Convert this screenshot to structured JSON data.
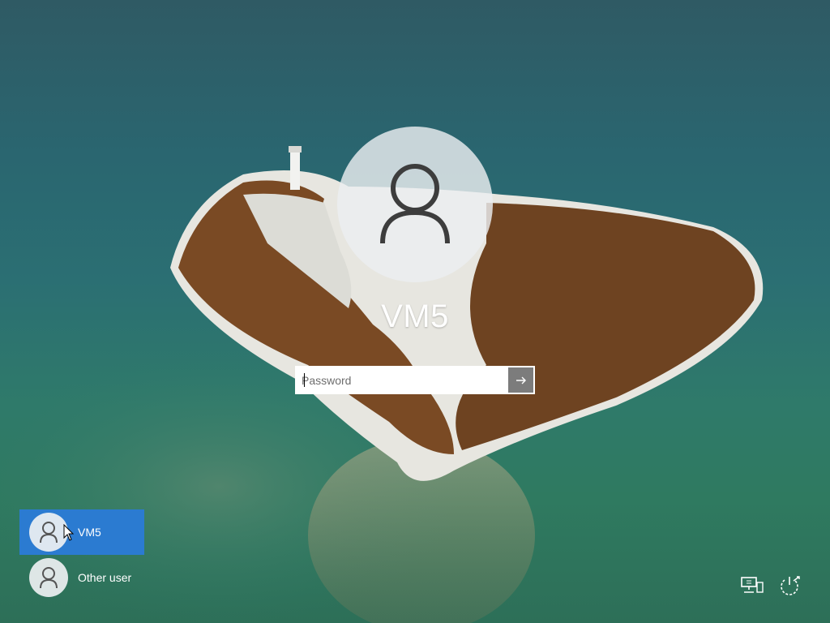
{
  "lockscreen": {
    "username": "VM5",
    "password_placeholder": "Password",
    "submit_icon": "arrow-right-icon",
    "avatar_icon": "user-silhouette-icon"
  },
  "user_list": [
    {
      "name": "VM5",
      "selected": true,
      "icon": "user-silhouette-icon"
    },
    {
      "name": "Other user",
      "selected": false,
      "icon": "user-silhouette-icon"
    }
  ],
  "corner_icons": {
    "network": "network-icon",
    "power": "power-icon"
  },
  "colors": {
    "selected_tile": "#2b7bd1",
    "text": "#ffffff",
    "water": "#2b6f73"
  }
}
